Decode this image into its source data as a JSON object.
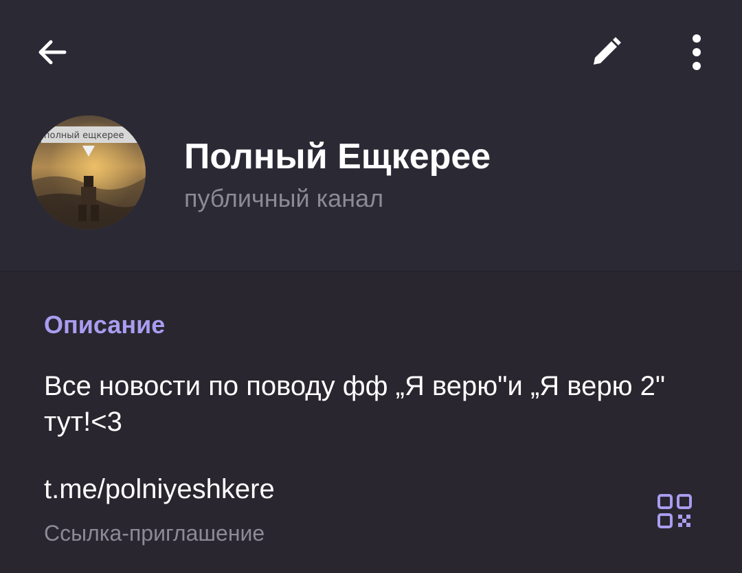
{
  "toolbar": {
    "back_icon": "arrow-left-icon",
    "edit_icon": "pencil-icon",
    "more_icon": "more-vertical-icon"
  },
  "channel": {
    "title": "Полный Ещкерее",
    "subtitle": "публичный канал",
    "avatar_caption": "полный ещкерее"
  },
  "description_section": {
    "title": "Описание",
    "text": "Все новости по поводу фф „Я верю\"и „Я верю 2\" тут!<3"
  },
  "link_section": {
    "link": "t.me/polniyeshkere",
    "caption": "Ссылка-приглашение",
    "qr_icon": "qr-code-icon"
  },
  "colors": {
    "header_bg": "#2b2934",
    "content_bg": "#29262f",
    "accent": "#a99df0",
    "secondary_text": "#8c8a96",
    "primary_text": "#ffffff"
  }
}
